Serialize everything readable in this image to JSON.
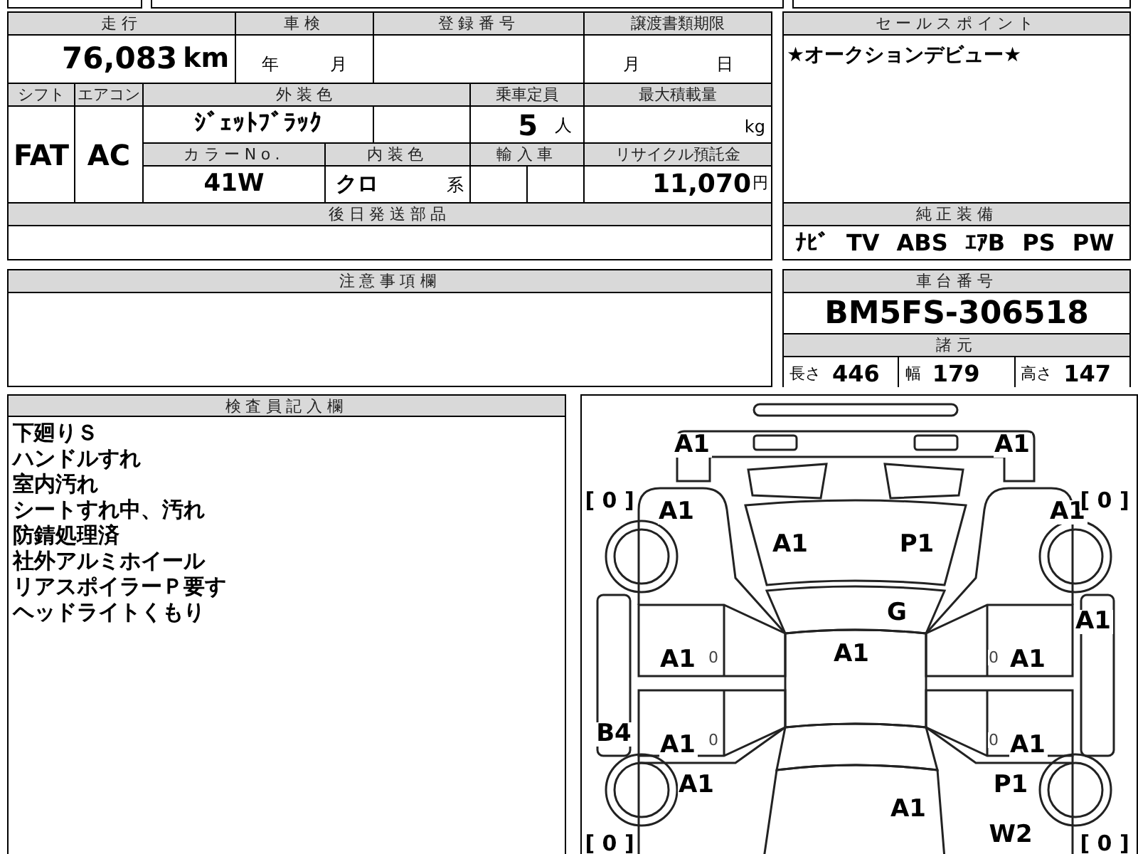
{
  "vehicle_table": {
    "mileage": {
      "label": "走行",
      "value": "76,083",
      "unit": "km"
    },
    "inspection": {
      "label": "車検",
      "year_unit": "年",
      "month_unit": "月"
    },
    "registration_number": {
      "label": "登録番号"
    },
    "transfer_deadline": {
      "label": "譲渡書類期限",
      "month_unit": "月",
      "day_unit": "日"
    },
    "shift": {
      "label": "シフト",
      "value": "FAT"
    },
    "air_conditioner": {
      "label": "エアコン",
      "value": "AC"
    },
    "exterior_color": {
      "label": "外装色",
      "value": "ｼﾞｪｯﾄﾌﾞﾗｯｸ"
    },
    "capacity": {
      "label": "乗車定員",
      "value": "5",
      "unit": "人"
    },
    "max_load": {
      "label": "最大積載量",
      "unit": "kg"
    },
    "color_number": {
      "label": "カラーNo.",
      "value": "41W"
    },
    "interior_color": {
      "label": "内装色",
      "value": "クロ",
      "suffix": "系"
    },
    "imported": {
      "label": "輸入車"
    },
    "recycling_deposit": {
      "label": "リサイクル預託金",
      "value": "11,070",
      "unit": "円"
    },
    "parts_sent_later": {
      "label": "後日発送部品"
    }
  },
  "sales_point": {
    "label": "セールスポイント",
    "text": "★オークションデビュー★"
  },
  "equipment": {
    "label": "純正装備",
    "items": [
      "ﾅﾋﾞ",
      "TV",
      "ABS",
      "ｴｱB",
      "PS",
      "PW"
    ]
  },
  "notes": {
    "label": "注意事項欄"
  },
  "chassis": {
    "label": "車台番号",
    "value": "BM5FS-306518",
    "specs_label": "諸元",
    "specs": [
      {
        "label": "長さ",
        "value": "446"
      },
      {
        "label": "幅",
        "value": "179"
      },
      {
        "label": "高さ",
        "value": "147"
      }
    ]
  },
  "inspector_notes": {
    "label": "検査員記入欄",
    "lines": [
      "下廻りＳ",
      "ハンドルすれ",
      "室内汚れ",
      "シートすれ中、汚れ",
      "防錆処理済",
      "社外アルミホイール",
      "リアスポイラーＰ要す",
      "ヘッドライトくもり"
    ]
  },
  "damage_diagram": {
    "marks": [
      {
        "text": "A1",
        "kind": "grade"
      },
      {
        "text": "A1",
        "kind": "grade"
      },
      {
        "text": "[ 0 ]",
        "kind": "tire"
      },
      {
        "text": "A1",
        "kind": "grade"
      },
      {
        "text": "A1",
        "kind": "grade"
      },
      {
        "text": "P1",
        "kind": "grade"
      },
      {
        "text": "A1",
        "kind": "grade"
      },
      {
        "text": "[ 0 ]",
        "kind": "tire"
      },
      {
        "text": "G",
        "kind": "grade"
      },
      {
        "text": "A1",
        "kind": "grade"
      },
      {
        "text": "A1",
        "kind": "grade"
      },
      {
        "text": "0",
        "kind": "small"
      },
      {
        "text": "A1",
        "kind": "grade"
      },
      {
        "text": "0",
        "kind": "small"
      },
      {
        "text": "A1",
        "kind": "grade"
      },
      {
        "text": "B4",
        "kind": "grade"
      },
      {
        "text": "A1",
        "kind": "grade"
      },
      {
        "text": "0",
        "kind": "small"
      },
      {
        "text": "0",
        "kind": "small"
      },
      {
        "text": "A1",
        "kind": "grade"
      },
      {
        "text": "A1",
        "kind": "grade"
      },
      {
        "text": "P1",
        "kind": "grade"
      },
      {
        "text": "A1",
        "kind": "grade"
      },
      {
        "text": "W2",
        "kind": "grade"
      },
      {
        "text": "[ 0 ]",
        "kind": "tire"
      },
      {
        "text": "[ 0 ]",
        "kind": "tire"
      }
    ]
  }
}
